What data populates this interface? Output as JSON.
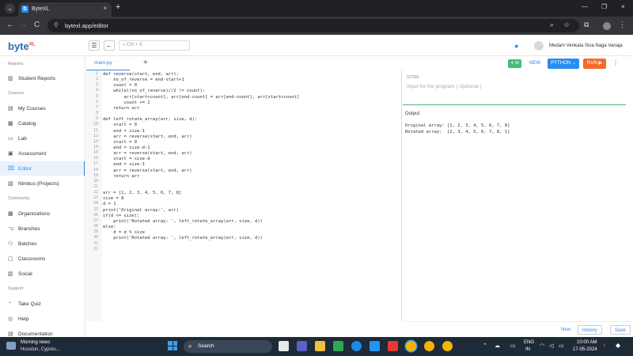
{
  "browser": {
    "tab_title": "ByteXL",
    "url": "bytexl.app/editor",
    "tab_close": "×",
    "new_tab": "+",
    "back": "←",
    "forward": "→",
    "reload": "C",
    "window_controls": [
      "—",
      "❐",
      "×"
    ]
  },
  "app": {
    "logo": "byte",
    "logo_sup": "XL",
    "search_placeholder": "Ctrl + K",
    "user_name": "Medam Venkata Siva Naga Vanaja"
  },
  "sidebar": {
    "sections": {
      "reports": "Reports",
      "courses": "Courses",
      "community": "Community",
      "support": "Support"
    },
    "items": [
      {
        "label": "Student Reports",
        "icon": "bar-chart-icon"
      },
      {
        "label": "My Courses",
        "icon": "book-icon"
      },
      {
        "label": "Catalog",
        "icon": "catalog-icon"
      },
      {
        "label": "Lab",
        "icon": "lab-icon"
      },
      {
        "label": "Assessment",
        "icon": "assessment-icon"
      },
      {
        "label": "Editor",
        "icon": "code-icon",
        "active": true
      },
      {
        "label": "Nimbus (Projects)",
        "icon": "folder-icon"
      },
      {
        "label": "Organizations",
        "icon": "organization-icon"
      },
      {
        "label": "Branches",
        "icon": "branch-icon"
      },
      {
        "label": "Batches",
        "icon": "batch-icon"
      },
      {
        "label": "Classrooms",
        "icon": "classroom-icon"
      },
      {
        "label": "Social",
        "icon": "social-icon"
      },
      {
        "label": "Take Quiz",
        "icon": "quiz-icon"
      },
      {
        "label": "Help",
        "icon": "help-icon"
      },
      {
        "label": "Documentation",
        "icon": "document-icon"
      }
    ]
  },
  "editor": {
    "file_tab": "main.py",
    "add_file": "+",
    "line_numbers": [
      "1",
      "2",
      "3",
      "4",
      "5",
      "6",
      "7",
      "8",
      "9",
      "10",
      "11",
      "12",
      "13",
      "14",
      "15",
      "16",
      "17",
      "18",
      "19",
      "20",
      "21",
      "22",
      "23",
      "24",
      "25",
      "26",
      "27",
      "28",
      "29",
      "30",
      "31",
      "32"
    ],
    "lines": [
      "def reverse(start, end, arr):",
      "    no_of_reverse = end-start+1",
      "    count = 0",
      "    while((no_of_reverse)//2 != count):",
      "        arr[start+count], arr[end-count] = arr[end-count], arr[start+count]",
      "        count += 1",
      "    return arr",
      "",
      "def left_rotate_array(arr, size, d):",
      "    start = 0",
      "    end = size-1",
      "    arr = reverse(start, end, arr)",
      "    start = 0",
      "    end = size-d-1",
      "    arr = reverse(start, end, arr)",
      "    start = size-d",
      "    end = size-1",
      "    arr = reverse(start, end, arr)",
      "    return arr",
      "",
      "",
      "arr = [1, 2, 3, 4, 5, 6, 7, 8]",
      "size = 8",
      "d = 1",
      "print('Original array:', arr)",
      "if(d <= size):",
      "    print('Rotated array: ', left_rotate_array(arr, size, d))",
      "else:",
      "    d = d % size",
      "    print('Rotated array: ', left_rotate_array(arr, size, d))",
      "",
      ""
    ]
  },
  "toolbar": {
    "ai_label": "✦ AI",
    "new_label": "NEW",
    "language": "PYTHON ⌄",
    "run_label": "RUN ▶",
    "more": "⋮"
  },
  "stdin": {
    "label": "STDIN",
    "placeholder": "Input for the program ( Optional )"
  },
  "output": {
    "label": "Output:",
    "lines": [
      "Original array: [1, 2, 3, 4, 5, 6, 7, 8]",
      "Rotated array:  [2, 3, 4, 5, 6, 7, 8, 1]"
    ]
  },
  "bottom_actions": {
    "new": "New",
    "history": "History",
    "save": "Save"
  },
  "taskbar": {
    "weather_title": "Morning news",
    "weather_sub": "Houston, Cypres...",
    "search_label": "Search",
    "lang_line1": "ENG",
    "lang_line2": "IN",
    "time": "10:00 AM",
    "date": "17-05-2024"
  }
}
